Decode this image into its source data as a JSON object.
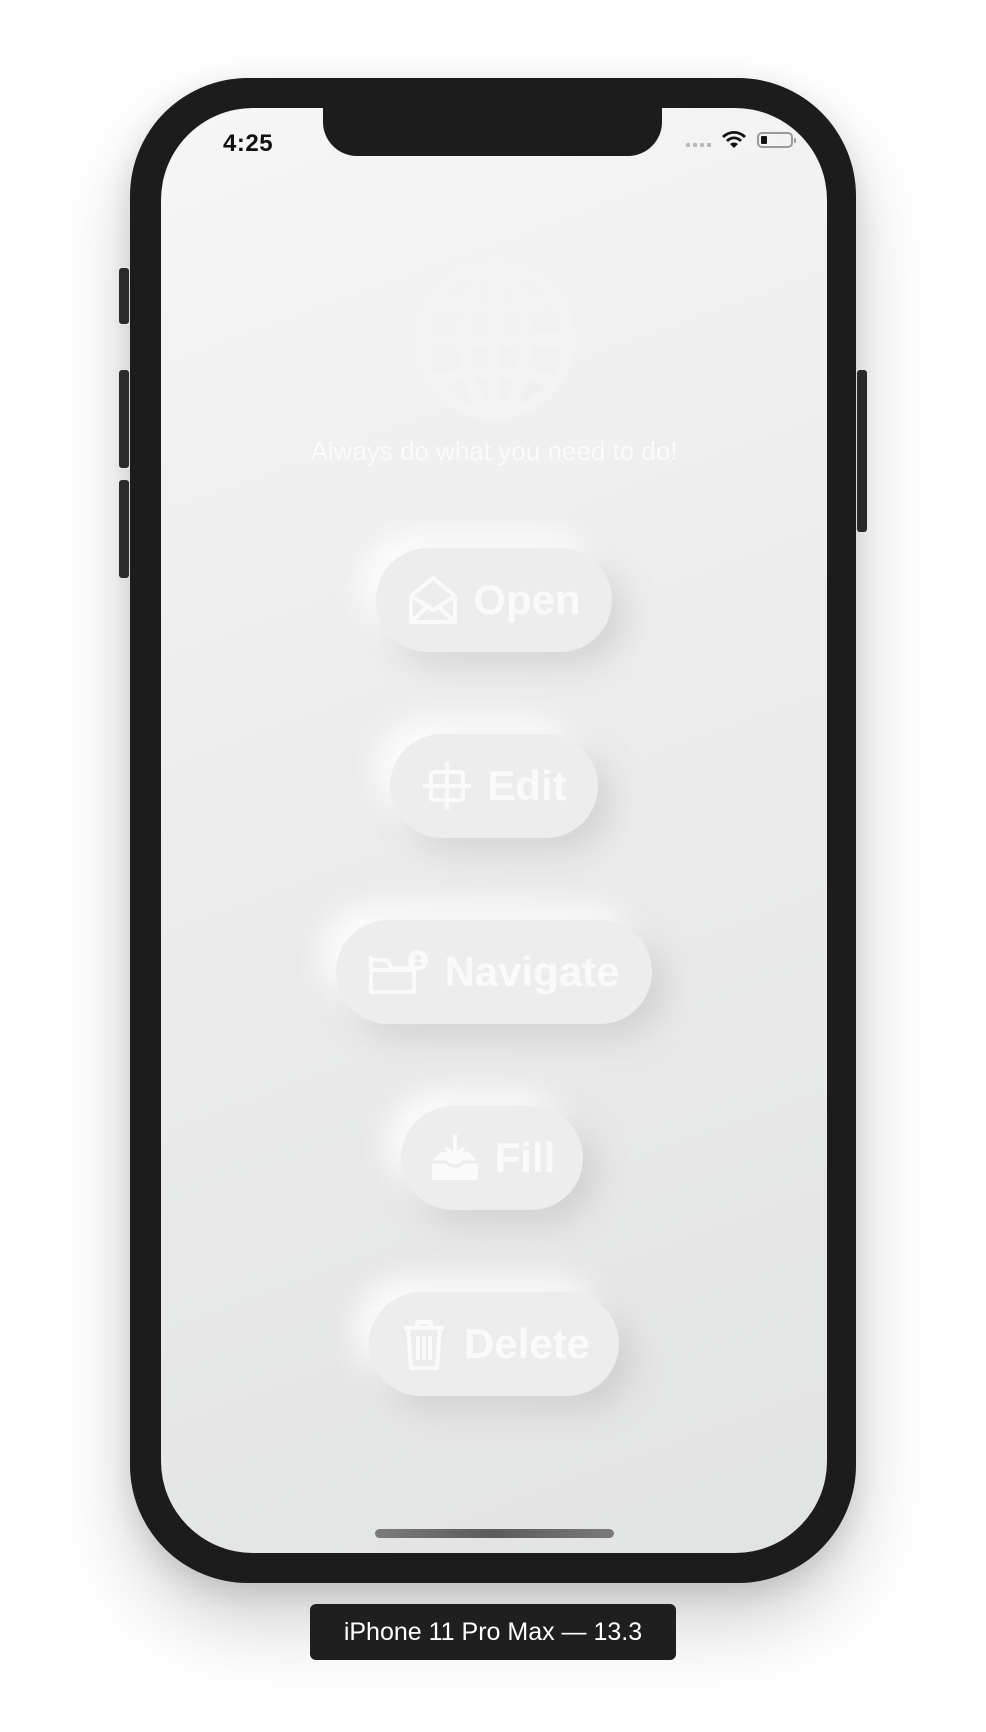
{
  "status_bar": {
    "time": "4:25"
  },
  "app": {
    "tagline": "Always do what you need to do!",
    "buttons": [
      {
        "label": "Open",
        "icon": "envelope-open-icon"
      },
      {
        "label": "Edit",
        "icon": "crop-icon"
      },
      {
        "label": "Navigate",
        "icon": "folder-badge-icon"
      },
      {
        "label": "Fill",
        "icon": "tray-download-icon"
      },
      {
        "label": "Delete",
        "icon": "trash-icon"
      }
    ]
  },
  "simulator": {
    "device_label": "iPhone 11 Pro Max — 13.3"
  },
  "colors": {
    "background": "#ececec",
    "foreground": "#fafafa",
    "frame": "#1c1c1c"
  }
}
